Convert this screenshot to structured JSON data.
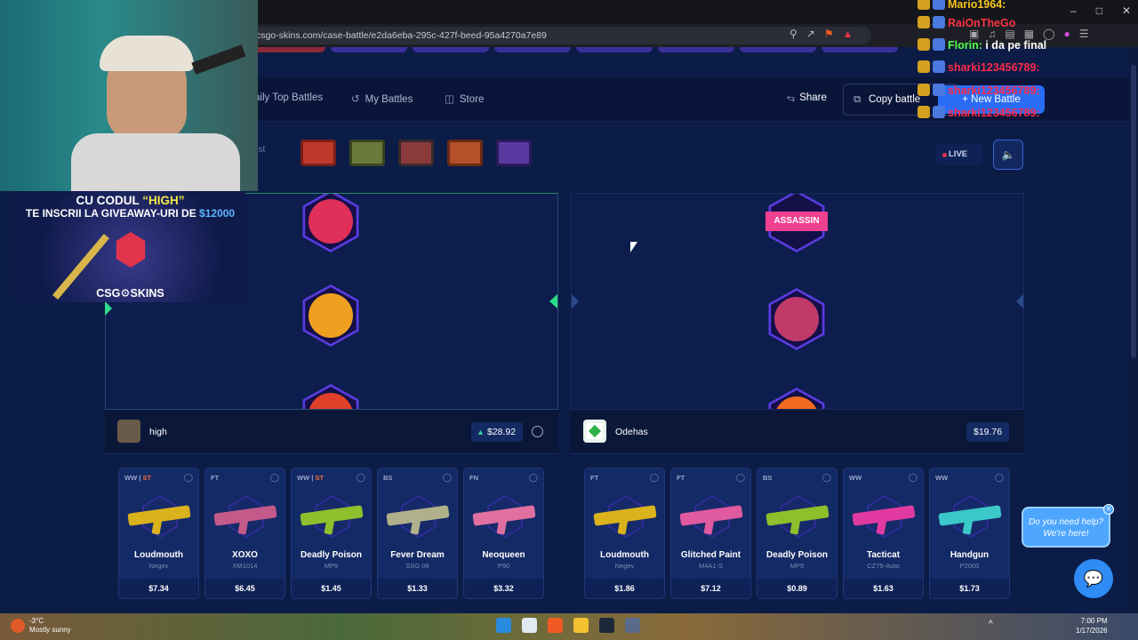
{
  "browser": {
    "url": "csgo-skins.com/case-battle/e2da6eba-295c-427f-beed-95a4270a7e89"
  },
  "nav": {
    "daily_top_battles": "aily Top Battles",
    "my_battles": "My Battles",
    "store": "Store",
    "share": "Share",
    "copy_battle": "Copy battle",
    "new_battle": "+ New Battle"
  },
  "cases_label": "ost",
  "live_label": "LIVE",
  "players": [
    {
      "name": "high",
      "total": "$28.92",
      "items": [
        {
          "condition": "WW",
          "stattrak": "ST",
          "name": "Loudmouth",
          "weapon": "Negev",
          "price": "$7.34",
          "color": "#d9b21c"
        },
        {
          "condition": "FT",
          "stattrak": "",
          "name": "XOXO",
          "weapon": "XM1014",
          "price": "$6.45",
          "color": "#c45a8a"
        },
        {
          "condition": "WW",
          "stattrak": "ST",
          "name": "Deadly Poison",
          "weapon": "MP9",
          "price": "$1.45",
          "color": "#8fbf2c"
        },
        {
          "condition": "BS",
          "stattrak": "",
          "name": "Fever Dream",
          "weapon": "SSG 08",
          "price": "$1.33",
          "color": "#b0b08a"
        },
        {
          "condition": "FN",
          "stattrak": "",
          "name": "Neoqueen",
          "weapon": "P90",
          "price": "$3.32",
          "color": "#e070a0"
        }
      ]
    },
    {
      "name": "Odehas",
      "total": "$19.76",
      "items": [
        {
          "condition": "FT",
          "stattrak": "",
          "name": "Loudmouth",
          "weapon": "Negev",
          "price": "$1.86",
          "color": "#d9b21c"
        },
        {
          "condition": "FT",
          "stattrak": "",
          "name": "Glitched Paint",
          "weapon": "M4A1-S",
          "price": "$7.12",
          "color": "#e05aa0"
        },
        {
          "condition": "BS",
          "stattrak": "",
          "name": "Deadly Poison",
          "weapon": "MP9",
          "price": "$0.89",
          "color": "#8fbf2c"
        },
        {
          "condition": "WW",
          "stattrak": "",
          "name": "Tacticat",
          "weapon": "CZ75-Auto",
          "price": "$1.63",
          "color": "#e03aa0"
        },
        {
          "condition": "WW",
          "stattrak": "",
          "name": "Handgun",
          "weapon": "P2000",
          "price": "$1.73",
          "color": "#3ac8c8"
        }
      ]
    }
  ],
  "spinner_right_sticker": "ASSASSIN",
  "promo": {
    "line1a": "CU CODUL ",
    "line1b": "“HIGH”",
    "line2a": "TE INSCRII LA GIVEAWAY-URI DE ",
    "line2b": "$12000",
    "logo": "CSG⚙SKINS"
  },
  "chat": [
    {
      "user": "Mario1964:",
      "msg": "",
      "color": "#f5c518"
    },
    {
      "user": "RaiOnTheGo",
      "msg": "",
      "color": "#ff3344"
    },
    {
      "user": "Florin:",
      "msg": " i da pe final",
      "color": "#4cff4c"
    },
    {
      "user": "sharki123456789:",
      "msg": "",
      "color": "#ff2a4a"
    },
    {
      "user": "sharki123456789:",
      "msg": "",
      "color": "#ff2a4a"
    },
    {
      "user": "sharki123456789:",
      "msg": "",
      "color": "#ff2a4a"
    }
  ],
  "help": {
    "line1": "Do you need help?",
    "line2": "We're here!"
  },
  "taskbar": {
    "temp": "-3°C",
    "weather": "Mostly sunny",
    "time": "7:00 PM",
    "date": "1/17/2026"
  }
}
